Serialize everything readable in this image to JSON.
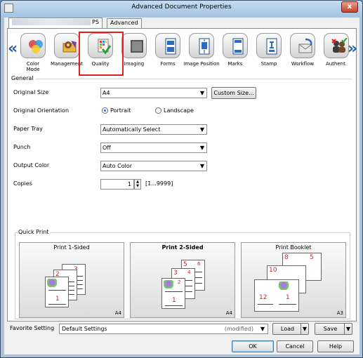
{
  "window": {
    "title": "Advanced Document Properties",
    "close_glyph": "x"
  },
  "tabs": [
    {
      "label": "PS"
    },
    {
      "label": "Advanced"
    }
  ],
  "nav": {
    "left": "«",
    "right": "»"
  },
  "categories": [
    {
      "label": "Color\nMode",
      "icon": "color-circles-icon"
    },
    {
      "label": "Management",
      "icon": "gear-folder-icon"
    },
    {
      "label": "Quality",
      "icon": "quality-grid-check-icon"
    },
    {
      "label": "Imaging",
      "icon": "imaging-square-icon"
    },
    {
      "label": "Forms",
      "icon": "forms-page-icon"
    },
    {
      "label": "Image Position",
      "icon": "image-position-page-icon"
    },
    {
      "label": "Marks",
      "icon": "marks-page-icon"
    },
    {
      "label": "Stamp",
      "icon": "stamp-page-icon"
    },
    {
      "label": "Workflow",
      "icon": "workflow-envelope-icon"
    },
    {
      "label": "Authent.",
      "icon": "users-authentication-icon"
    }
  ],
  "general": {
    "heading": "General",
    "original_size": {
      "label": "Original Size",
      "value": "A4",
      "button": "Custom Size..."
    },
    "original_orientation": {
      "label": "Original Orientation",
      "options": [
        "Portrait",
        "Landscape"
      ],
      "selected": "Portrait"
    },
    "paper_tray": {
      "label": "Paper Tray",
      "value": "Automatically Select"
    },
    "punch": {
      "label": "Punch",
      "value": "Off"
    },
    "output_color": {
      "label": "Output Color",
      "value": "Auto Color"
    },
    "copies": {
      "label": "Copies",
      "value": "1",
      "range": "[1...9999]"
    }
  },
  "quick_print": {
    "heading": "Quick Print",
    "presets": [
      {
        "name": "Print 1-Sided",
        "paper": "A4",
        "pages": [
          "1",
          "2",
          "3"
        ]
      },
      {
        "name": "Print 2-Sided",
        "paper": "A4",
        "pages": [
          "1",
          "2",
          "3",
          "4",
          "5",
          "6"
        ]
      },
      {
        "name": "Print Booklet",
        "paper": "A3",
        "pages": [
          "1",
          "12",
          "10",
          "8",
          "5"
        ]
      }
    ],
    "selected": "Print 2-Sided"
  },
  "favorite": {
    "label": "Favorite Setting",
    "value": "Default Settings",
    "status": "(modified)",
    "load": "Load",
    "save": "Save"
  },
  "buttons": {
    "ok": "OK",
    "cancel": "Cancel",
    "help": "Help"
  }
}
